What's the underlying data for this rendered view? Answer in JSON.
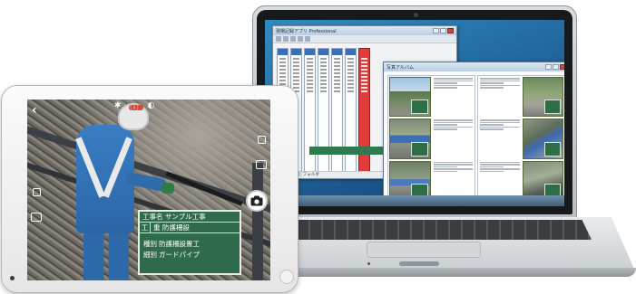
{
  "laptop": {
    "window_folders": {
      "title": "現場記録アプリ Professional",
      "status": "データベース: フォルダ"
    },
    "window_album": {
      "title": "写真アルバム"
    },
    "colors": {
      "accent_red": "#e23b3b",
      "blackboard_green": "#2f6b4b"
    }
  },
  "tablet": {
    "top_icons": [
      "flash-icon",
      "info-icon",
      "mode-icon"
    ],
    "blackboard": {
      "title": "工事名 サンプル工事",
      "row_key": "工",
      "row_value": "重 防護柵設",
      "line1_key": "種別",
      "line1_value": "防護柵設置工",
      "line2_key": "細別",
      "line2_value": "ガードパイプ"
    }
  }
}
